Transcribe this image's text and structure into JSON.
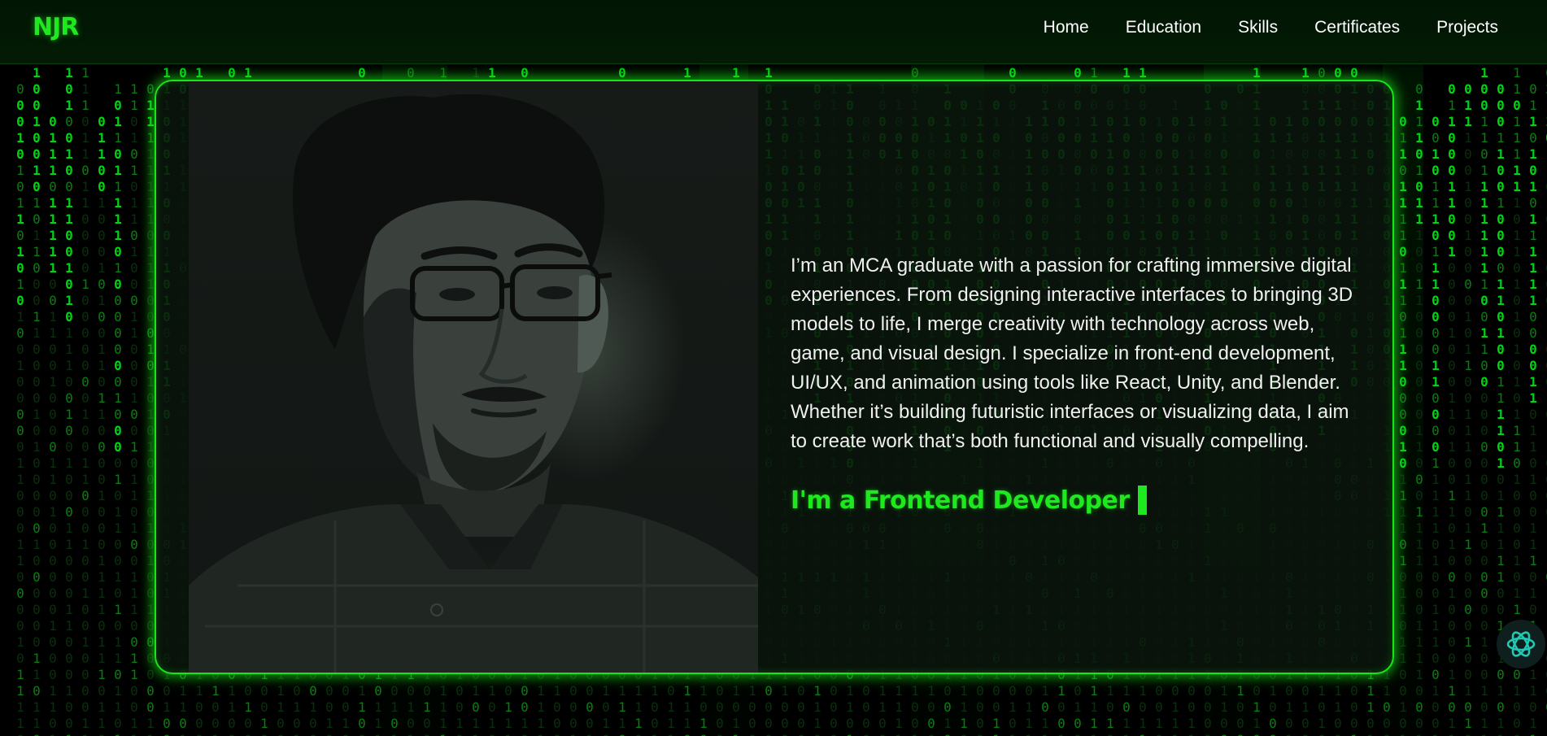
{
  "navbar": {
    "logo": "NJR",
    "links": [
      "Home",
      "Education",
      "Skills",
      "Certificates",
      "Projects"
    ]
  },
  "hero": {
    "about": "I’m an MCA graduate with a passion for crafting immersive digital experiences. From designing interactive interfaces to bringing 3D models to life, I merge creativity with technology across web, game, and visual design. I specialize in front-end development, UI/UX, and animation using tools like React, Unity, and Blender. Whether it’s building futuristic interfaces or visualizing data, I aim to create work that’s both functional and visually compelling.",
    "typing_text": "I'm a Frontend Developer"
  },
  "colors": {
    "accent": "#1ee81e",
    "background": "#000000",
    "card_border": "#19e619",
    "text": "#f0f0f0"
  },
  "icons": {
    "ai_button": "openai-icon"
  }
}
